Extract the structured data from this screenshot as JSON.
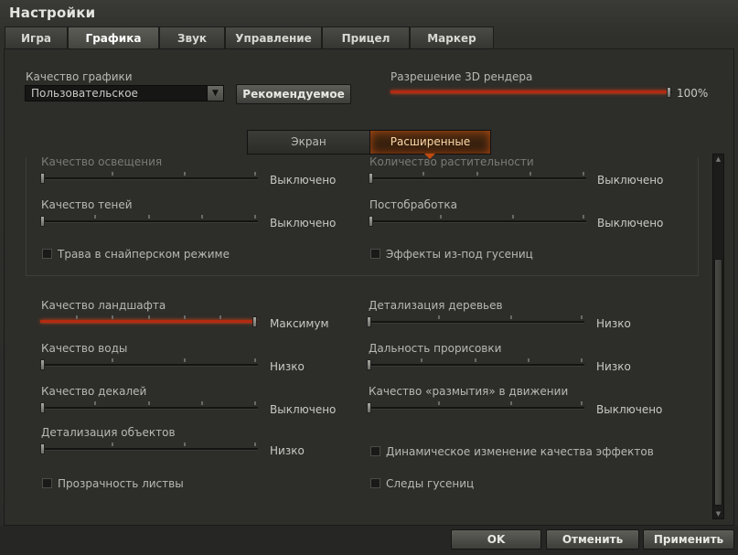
{
  "window": {
    "title": "Настройки"
  },
  "tabs": [
    "Игра",
    "Графика",
    "Звук",
    "Управление",
    "Прицел",
    "Маркер"
  ],
  "graphics_quality": {
    "label": "Качество графики",
    "selected": "Пользовательское",
    "recommended_label": "Рекомендуемое"
  },
  "render_resolution": {
    "label": "Разрешение 3D рендера",
    "value_text": "100%",
    "value": 1.0
  },
  "modes": {
    "screen": "Экран",
    "advanced": "Расширенные"
  },
  "left": {
    "lighting": {
      "label": "Качество освещения",
      "value": "Выключено"
    },
    "shadows": {
      "label": "Качество теней",
      "value": "Выключено"
    },
    "sniper_grass": "Трава в снайперском режиме",
    "landscape": {
      "label": "Качество ландшафта",
      "value": "Максимум"
    },
    "water": {
      "label": "Качество воды",
      "value": "Низко"
    },
    "decals": {
      "label": "Качество декалей",
      "value": "Выключено"
    },
    "objects": {
      "label": "Детализация объектов",
      "value": "Низко"
    },
    "foliage": "Прозрачность листвы"
  },
  "right": {
    "vegetation": {
      "label": "Количество растительности",
      "value": "Выключено"
    },
    "postprocessing": {
      "label": "Постобработка",
      "value": "Выключено"
    },
    "track_effects": "Эффекты из-под гусениц",
    "trees": {
      "label": "Детализация деревьев",
      "value": "Низко"
    },
    "draw_distance": {
      "label": "Дальность прорисовки",
      "value": "Низко"
    },
    "motion_blur": {
      "label": "Качество «размытия» в движении",
      "value": "Выключено"
    },
    "dynamic_effects": "Динамическое изменение качества эффектов",
    "track_marks": "Следы гусениц"
  },
  "footer": {
    "ok": "OK",
    "cancel": "Отменить",
    "apply": "Применить"
  }
}
